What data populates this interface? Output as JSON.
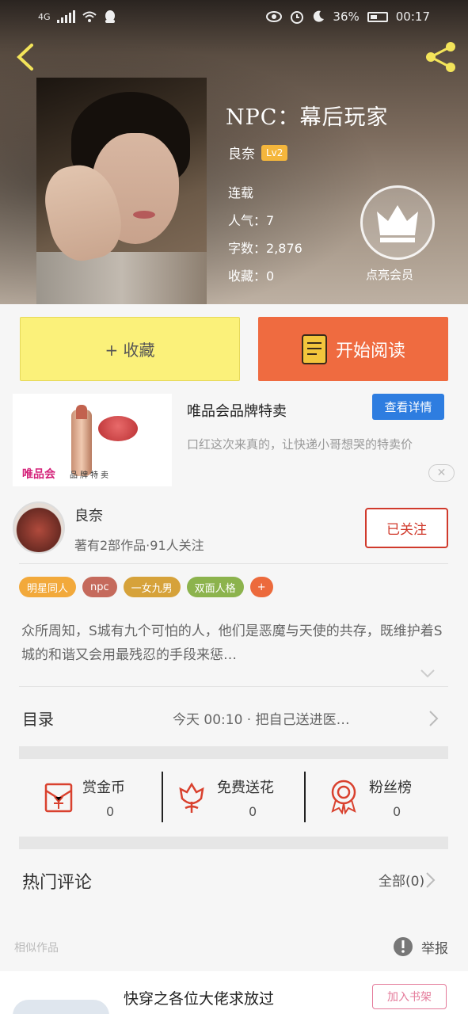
{
  "status_bar": {
    "network": "4G",
    "battery": "36%",
    "time": "00:17"
  },
  "book": {
    "title": "NPC：幕后玩家",
    "author": "良奈",
    "level": "Lv2",
    "status": "连载",
    "popularity": "人气：7",
    "word_count": "字数：2,876",
    "favorites": "收藏：0"
  },
  "vip_label": "点亮会员",
  "actions": {
    "favorite": "+ 收藏",
    "read": "开始阅读"
  },
  "ad": {
    "title": "唯品会品牌特卖",
    "description": "口红这次来真的，让快递小哥想哭的特卖价",
    "button": "查看详情",
    "brand": "唯品会",
    "brand_sub": "品牌特卖",
    "close": "✕"
  },
  "author_row": {
    "name": "良奈",
    "stats": "著有2部作品·91人关注",
    "follow": "已关注"
  },
  "tags": [
    {
      "label": "明星同人",
      "color": "#f2a93b"
    },
    {
      "label": "npc",
      "color": "#c56a5c"
    },
    {
      "label": "一女九男",
      "color": "#d6a23a"
    },
    {
      "label": "双面人格",
      "color": "#8cb34d"
    },
    {
      "label": "+",
      "color": "#ec6a3c"
    }
  ],
  "description": "众所周知，S城有九个可怕的人，他们是恶魔与天使的共存，既维护着S城的和谐又会用最残忍的手段来惩…",
  "toc": {
    "label": "目录",
    "latest": "今天 00:10 · 把自己送进医…"
  },
  "rewards": [
    {
      "label": "赏金币",
      "count": "0",
      "icon": "coin-envelope-icon"
    },
    {
      "label": "免费送花",
      "count": "0",
      "icon": "flower-icon"
    },
    {
      "label": "粉丝榜",
      "count": "0",
      "icon": "medal-icon"
    }
  ],
  "comments": {
    "label": "热门评论",
    "all": "全部(0)"
  },
  "similar": "相似作品",
  "report": "举报",
  "bottom_card": {
    "title": "快穿之各位大佬求放过",
    "button": "加入书架"
  }
}
